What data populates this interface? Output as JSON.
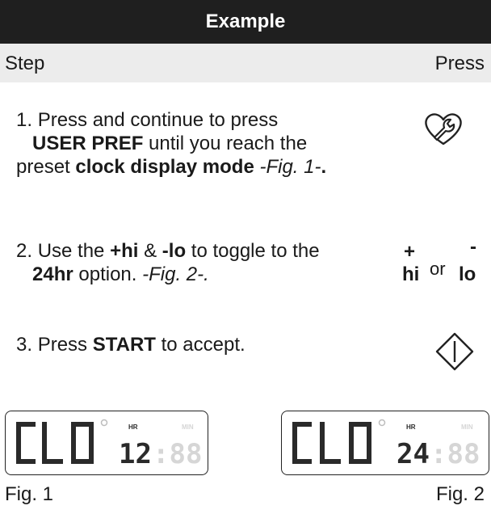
{
  "header": {
    "title": "Example"
  },
  "columns": {
    "step": "Step",
    "press": "Press"
  },
  "steps": [
    {
      "number": "1.",
      "t1": "Press and continue to press",
      "b1": "USER PREF",
      "t2": "until you reach the preset",
      "b2": "clock display mode",
      "i1": "-Fig. 1-",
      "b3": ".",
      "icon": "user-pref-wrench-icon"
    },
    {
      "number": "2.",
      "t1": "Use the",
      "b1": "+hi",
      "t2": "&",
      "b2": "-lo",
      "t3": "to toggle to the",
      "b3": "24hr",
      "t4": "option.",
      "i1": "-Fig. 2-."
    },
    {
      "number": "3.",
      "t1": "Press",
      "b1": "START",
      "t2": "to accept.",
      "icon": "start-icon"
    }
  ],
  "press_hilo": {
    "plus": "+",
    "minus": "-",
    "hi": "hi",
    "or": "or",
    "lo": "lo"
  },
  "figures": [
    {
      "caption": "Fig. 1",
      "text": "CLO",
      "time": "12",
      "hr": "HR",
      "min": "MIN"
    },
    {
      "caption": "Fig. 2",
      "text": "CLO",
      "time": "24",
      "hr": "HR",
      "min": "MIN"
    }
  ],
  "colors": {
    "header_bg": "#1f1f1f",
    "subheader_bg": "#ececec",
    "lcd_on": "#2a2a2a",
    "lcd_off": "#d6d6d6"
  }
}
